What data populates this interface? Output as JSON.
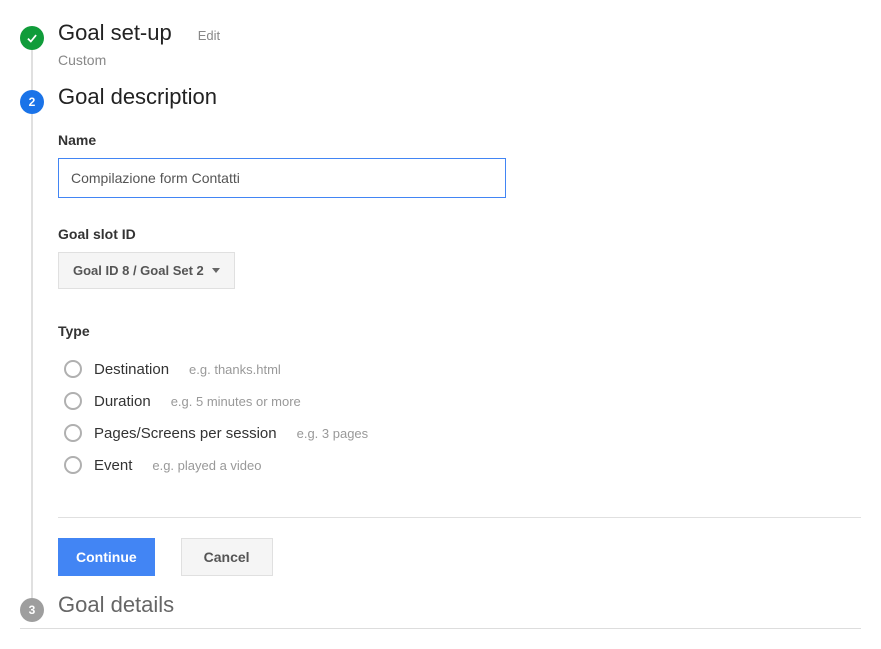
{
  "step1": {
    "title": "Goal set-up",
    "edit": "Edit",
    "subtitle": "Custom"
  },
  "step2": {
    "number": "2",
    "title": "Goal description",
    "name_label": "Name",
    "name_value": "Compilazione form Contatti",
    "slot_label": "Goal slot ID",
    "slot_value": "Goal ID 8 / Goal Set 2",
    "type_label": "Type",
    "types": [
      {
        "label": "Destination",
        "hint": "e.g. thanks.html"
      },
      {
        "label": "Duration",
        "hint": "e.g. 5 minutes or more"
      },
      {
        "label": "Pages/Screens per session",
        "hint": "e.g. 3 pages"
      },
      {
        "label": "Event",
        "hint": "e.g. played a video"
      }
    ],
    "continue": "Continue",
    "cancel": "Cancel"
  },
  "step3": {
    "number": "3",
    "title": "Goal details"
  }
}
